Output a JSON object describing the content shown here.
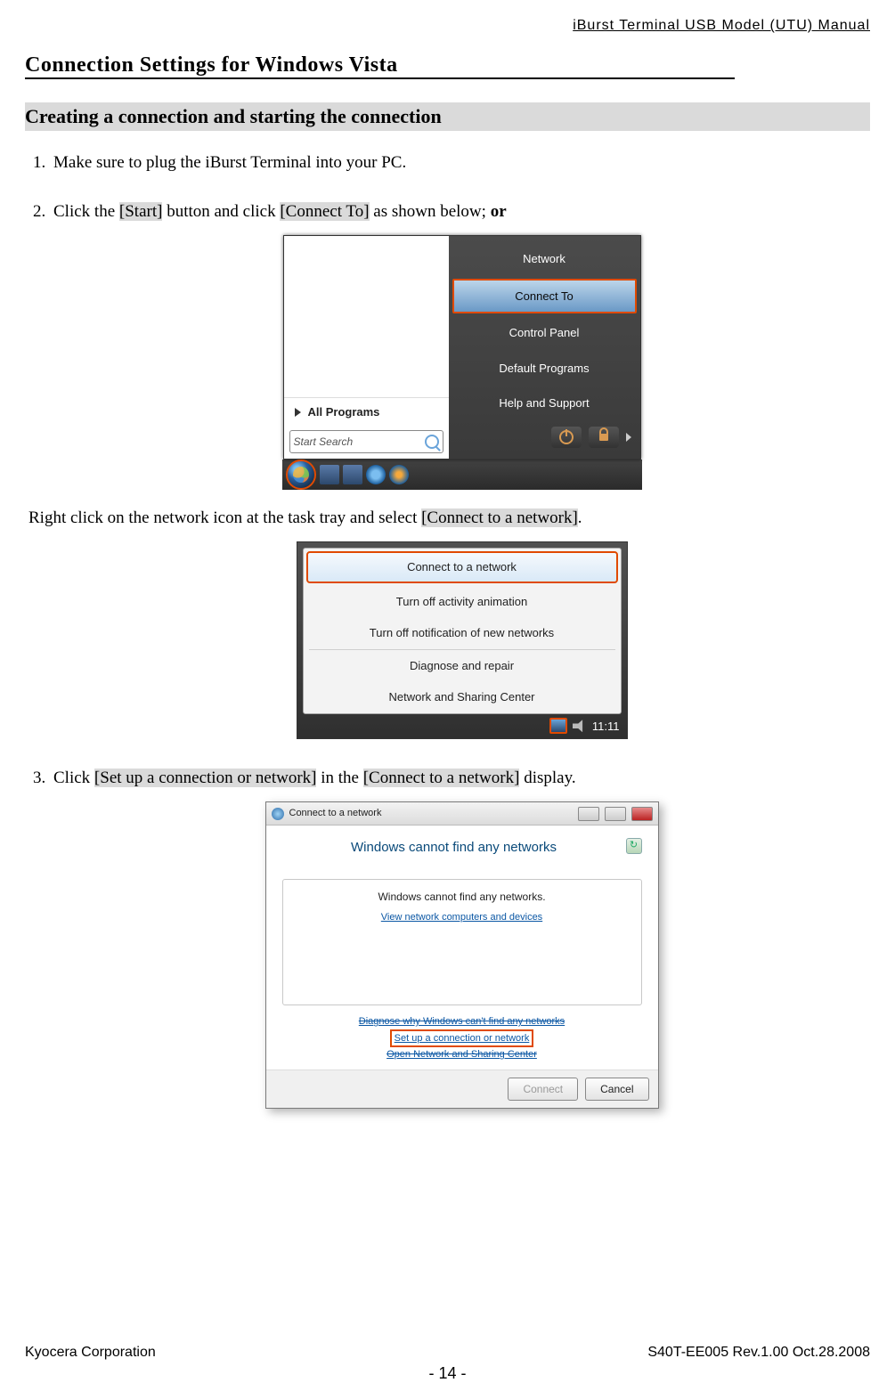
{
  "header": {
    "right": "iBurst  Terminal  USB  Model  (UTU)  Manual"
  },
  "section_title": "Connection Settings for Windows Vista",
  "subsection_title": "Creating a connection and starting the connection",
  "steps": {
    "s1": "Make sure to plug the iBurst Terminal into your PC.",
    "s2_a": "Click the ",
    "s2_start": "[Start]",
    "s2_b": " button and click ",
    "s2_connect": "[Connect To]",
    "s2_c": " as shown below; ",
    "s2_or": "or",
    "s2_line2_a": "Right click on the network icon at the task tray and select ",
    "s2_ctn": "[Connect to a network]",
    "s2_line2_b": ".",
    "s3_a": "Click ",
    "s3_setup": "[Set up a connection or network]",
    "s3_b": " in the ",
    "s3_ctn": "[Connect to a network]",
    "s3_c": " display."
  },
  "startmenu": {
    "all_programs": "All Programs",
    "search_placeholder": "Start Search",
    "right_items": [
      "Network",
      "Connect To",
      "Control Panel",
      "Default Programs",
      "Help and Support"
    ]
  },
  "traymenu": {
    "items": [
      "Connect to a network",
      "Turn off activity animation",
      "Turn off notification of new networks",
      "Diagnose and repair",
      "Network and Sharing Center"
    ],
    "clock": "11:11"
  },
  "dialog": {
    "title": "Connect to a network",
    "heading": "Windows cannot find any networks",
    "box_msg": "Windows cannot find any networks.",
    "box_link": "View network computers and devices",
    "link_diag": "Diagnose why Windows can't find any networks",
    "link_setup": "Set up a connection or network",
    "link_open": "Open Network and Sharing Center",
    "btn_connect": "Connect",
    "btn_cancel": "Cancel"
  },
  "footer": {
    "left": "Kyocera Corporation",
    "right": "S40T-EE005 Rev.1.00 Oct.28.2008",
    "page": "- 14 -"
  }
}
